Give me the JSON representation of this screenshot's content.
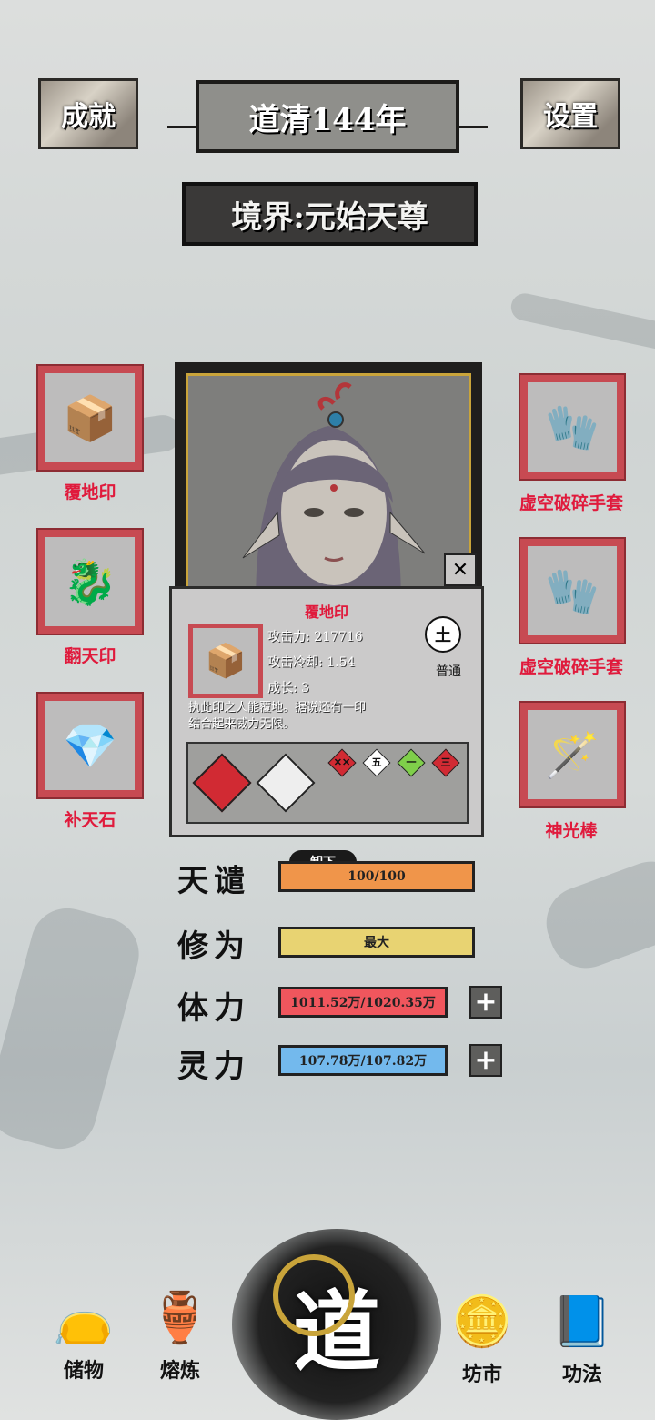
{
  "header": {
    "achievements_label": "成就",
    "year_label": "道清144年",
    "settings_label": "设置",
    "realm_label": "境界:元始天尊"
  },
  "left_equipment": [
    {
      "name": "覆地印",
      "icon": "seal-chest-icon"
    },
    {
      "name": "翻天印",
      "icon": "dragon-seal-icon"
    },
    {
      "name": "补天石",
      "icon": "crystal-stone-icon"
    }
  ],
  "right_equipment": [
    {
      "name": "虚空破碎手套",
      "icon": "void-glove-icon"
    },
    {
      "name": "虚空破碎手套",
      "icon": "void-glove-icon"
    },
    {
      "name": "神光棒",
      "icon": "light-staff-icon"
    }
  ],
  "item_popup": {
    "title": "覆地印",
    "attack_label": "攻击力:",
    "attack_value": "217716",
    "cooldown_label": "攻击冷却:",
    "cooldown_value": "1.54",
    "growth_label": "成长:",
    "growth_value": "3",
    "element": "土",
    "rarity": "普通",
    "description_line1": "执此印之人能覆地。据说还有一印",
    "description_line2": "结合起来威力无限。",
    "slots": [
      "✕✕",
      "五",
      "一",
      "三"
    ],
    "close_label": "✕",
    "unequip_label": "卸下"
  },
  "stats": {
    "tianqian_label": "天谴",
    "tianqian_value": "100/100",
    "cultivation_label": "修为",
    "cultivation_value": "最大",
    "stamina_label": "体力",
    "stamina_value": "1011.52万/1020.35万",
    "spirit_label": "灵力",
    "spirit_value": "107.78万/107.82万",
    "plus_label": "+"
  },
  "nav": {
    "storage": "储物",
    "smelt": "熔炼",
    "dao": "道",
    "market": "坊市",
    "techniques": "功法"
  },
  "colors": {
    "slot_red": "#c74a52",
    "label_red": "#e01a3c",
    "tianqian_bar": "#f0954a",
    "cultivation_bar": "#e8d372",
    "stamina_bar": "#f0565d",
    "spirit_bar": "#73b9ed",
    "gold": "#c9a43a"
  }
}
